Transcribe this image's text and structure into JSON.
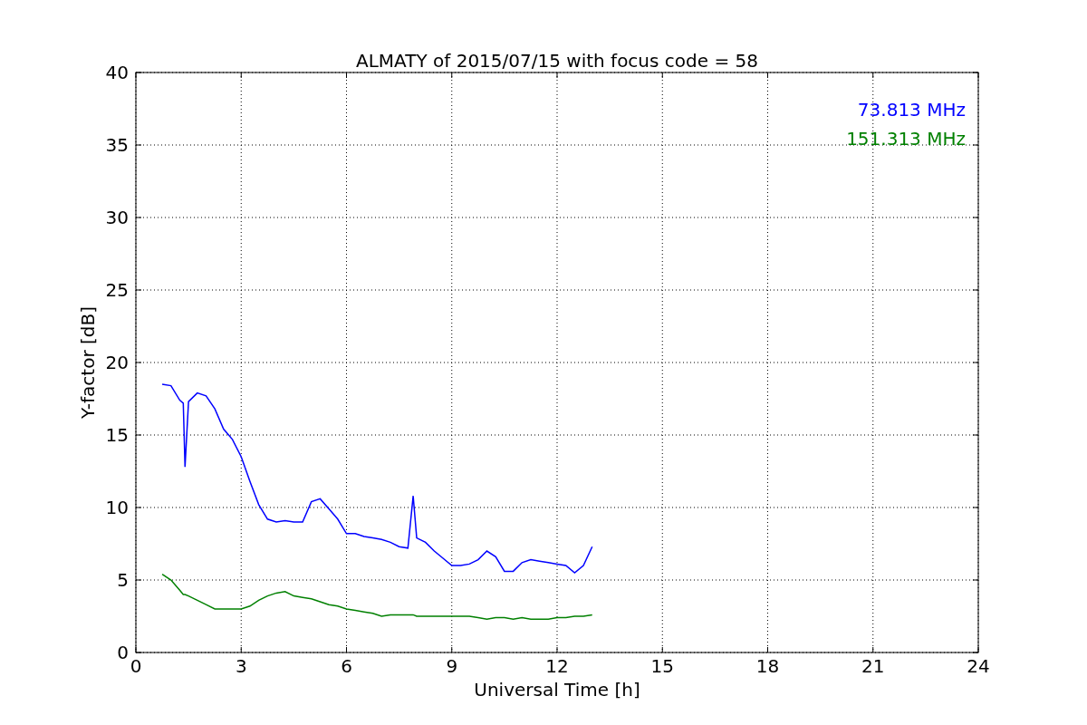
{
  "chart_data": {
    "type": "line",
    "title": "ALMATY of 2015/07/15 with focus code = 58",
    "xlabel": "Universal Time [h]",
    "ylabel": "Y-factor [dB]",
    "x": [
      0.75,
      1.0,
      1.25,
      1.35,
      1.4,
      1.5,
      1.75,
      2.0,
      2.25,
      2.5,
      2.75,
      3.0,
      3.25,
      3.5,
      3.75,
      4.0,
      4.25,
      4.5,
      4.75,
      5.0,
      5.25,
      5.5,
      5.75,
      6.0,
      6.25,
      6.5,
      6.75,
      7.0,
      7.25,
      7.5,
      7.75,
      7.9,
      8.0,
      8.25,
      8.5,
      8.75,
      9.0,
      9.25,
      9.5,
      9.75,
      10.0,
      10.25,
      10.5,
      10.75,
      11.0,
      11.25,
      11.5,
      11.75,
      12.0,
      12.25,
      12.5,
      12.75,
      13.0
    ],
    "series": [
      {
        "name": "73.813 MHz",
        "color": "#0000ff",
        "values": [
          18.5,
          18.4,
          17.4,
          17.2,
          12.8,
          17.3,
          17.9,
          17.7,
          16.8,
          15.4,
          14.7,
          13.5,
          11.8,
          10.2,
          9.2,
          9.0,
          9.1,
          9.0,
          9.0,
          10.4,
          10.6,
          9.9,
          9.2,
          8.2,
          8.2,
          8.0,
          7.9,
          7.8,
          7.6,
          7.3,
          7.2,
          10.8,
          7.9,
          7.6,
          7.0,
          6.5,
          6.0,
          6.0,
          6.1,
          6.4,
          7.0,
          6.6,
          5.6,
          5.6,
          6.2,
          6.4,
          6.3,
          6.2,
          6.1,
          6.0,
          5.5,
          6.0,
          7.3
        ]
      },
      {
        "name": "151.313 MHz",
        "color": "#008000",
        "values": [
          5.4,
          5.0,
          4.3,
          4.0,
          4.0,
          3.9,
          3.6,
          3.3,
          3.0,
          3.0,
          3.0,
          3.0,
          3.2,
          3.6,
          3.9,
          4.1,
          4.2,
          3.9,
          3.8,
          3.7,
          3.5,
          3.3,
          3.2,
          3.0,
          2.9,
          2.8,
          2.7,
          2.5,
          2.6,
          2.6,
          2.6,
          2.6,
          2.5,
          2.5,
          2.5,
          2.5,
          2.5,
          2.5,
          2.5,
          2.4,
          2.3,
          2.4,
          2.4,
          2.3,
          2.4,
          2.3,
          2.3,
          2.3,
          2.4,
          2.4,
          2.5,
          2.5,
          2.6
        ]
      }
    ],
    "xlim": [
      0,
      24
    ],
    "ylim": [
      0,
      40
    ],
    "xticks": [
      0,
      3,
      6,
      9,
      12,
      15,
      18,
      21,
      24
    ],
    "yticks": [
      0,
      5,
      10,
      15,
      20,
      25,
      30,
      35,
      40
    ],
    "grid": true
  }
}
